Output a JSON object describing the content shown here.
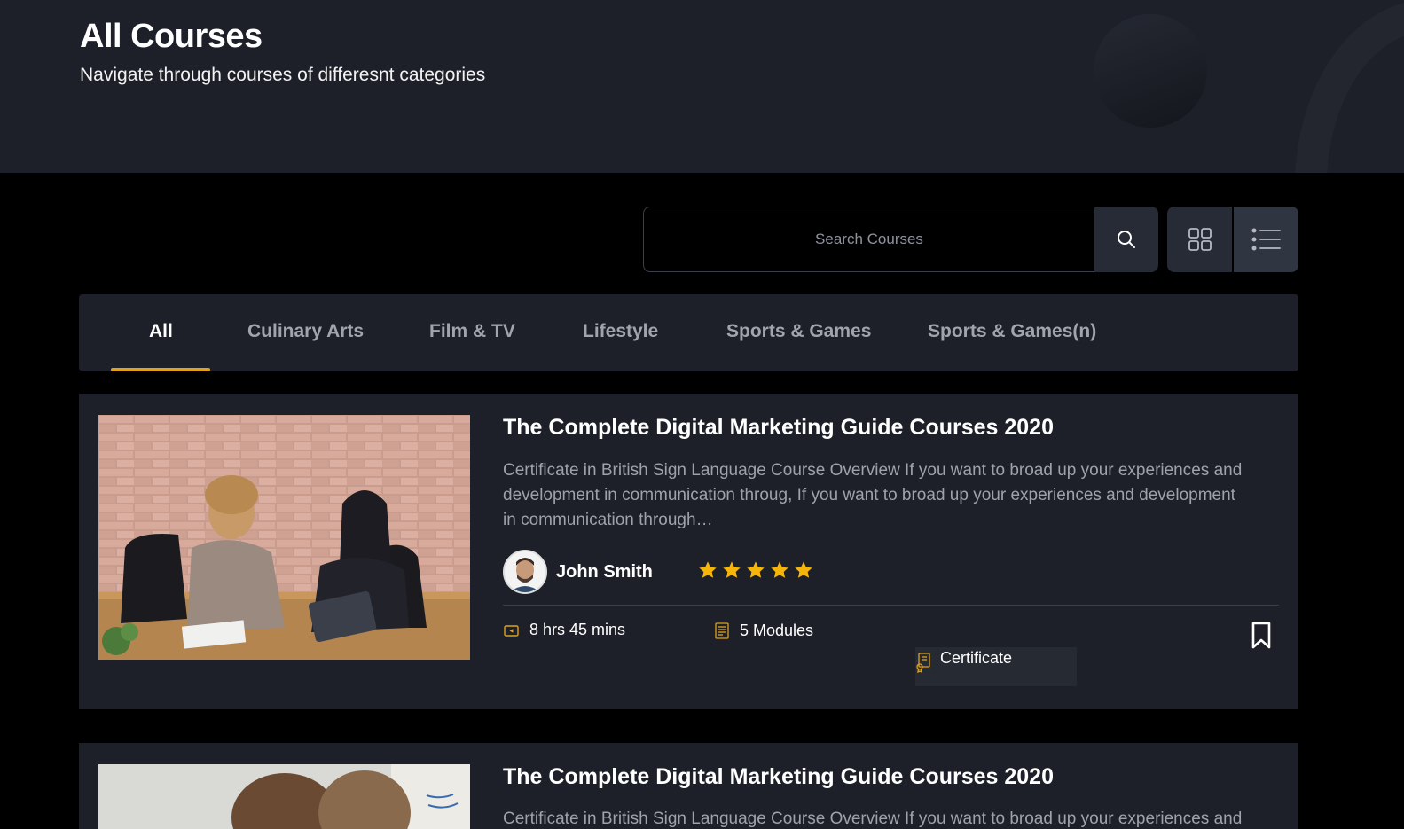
{
  "hero": {
    "title": "All Courses",
    "subtitle": "Navigate through courses of differesnt categories"
  },
  "search": {
    "placeholder": "Search Courses",
    "button_icon": "search-icon"
  },
  "view_toggle": {
    "grid_icon": "grid-view-icon",
    "list_icon": "list-view-icon",
    "selected": "list"
  },
  "tabs": [
    {
      "label": "All",
      "active": true
    },
    {
      "label": "Culinary Arts",
      "active": false
    },
    {
      "label": "Film & TV",
      "active": false
    },
    {
      "label": "Lifestyle",
      "active": false
    },
    {
      "label": "Sports & Games",
      "active": false
    },
    {
      "label": "Sports & Games(n)",
      "active": false
    }
  ],
  "courses": [
    {
      "title": "The Complete Digital Marketing Guide Courses 2020",
      "description": "Certificate in British Sign Language Course Overview If you want to broad up your experiences and development in communication throug, If you want to broad up your experiences and development in communication through…",
      "author": "John Smith",
      "rating": 5,
      "duration": "8 hrs 45 mins",
      "modules": "5 Modules",
      "certificate": "Certificate"
    },
    {
      "title": "The Complete Digital Marketing Guide Courses 2020",
      "description": "Certificate in British Sign Language Course Overview If you want to broad up your experiences and"
    }
  ],
  "colors": {
    "accent": "#e0a11b",
    "star": "#f5b50a",
    "panel": "#1d2029",
    "background": "#000000"
  }
}
